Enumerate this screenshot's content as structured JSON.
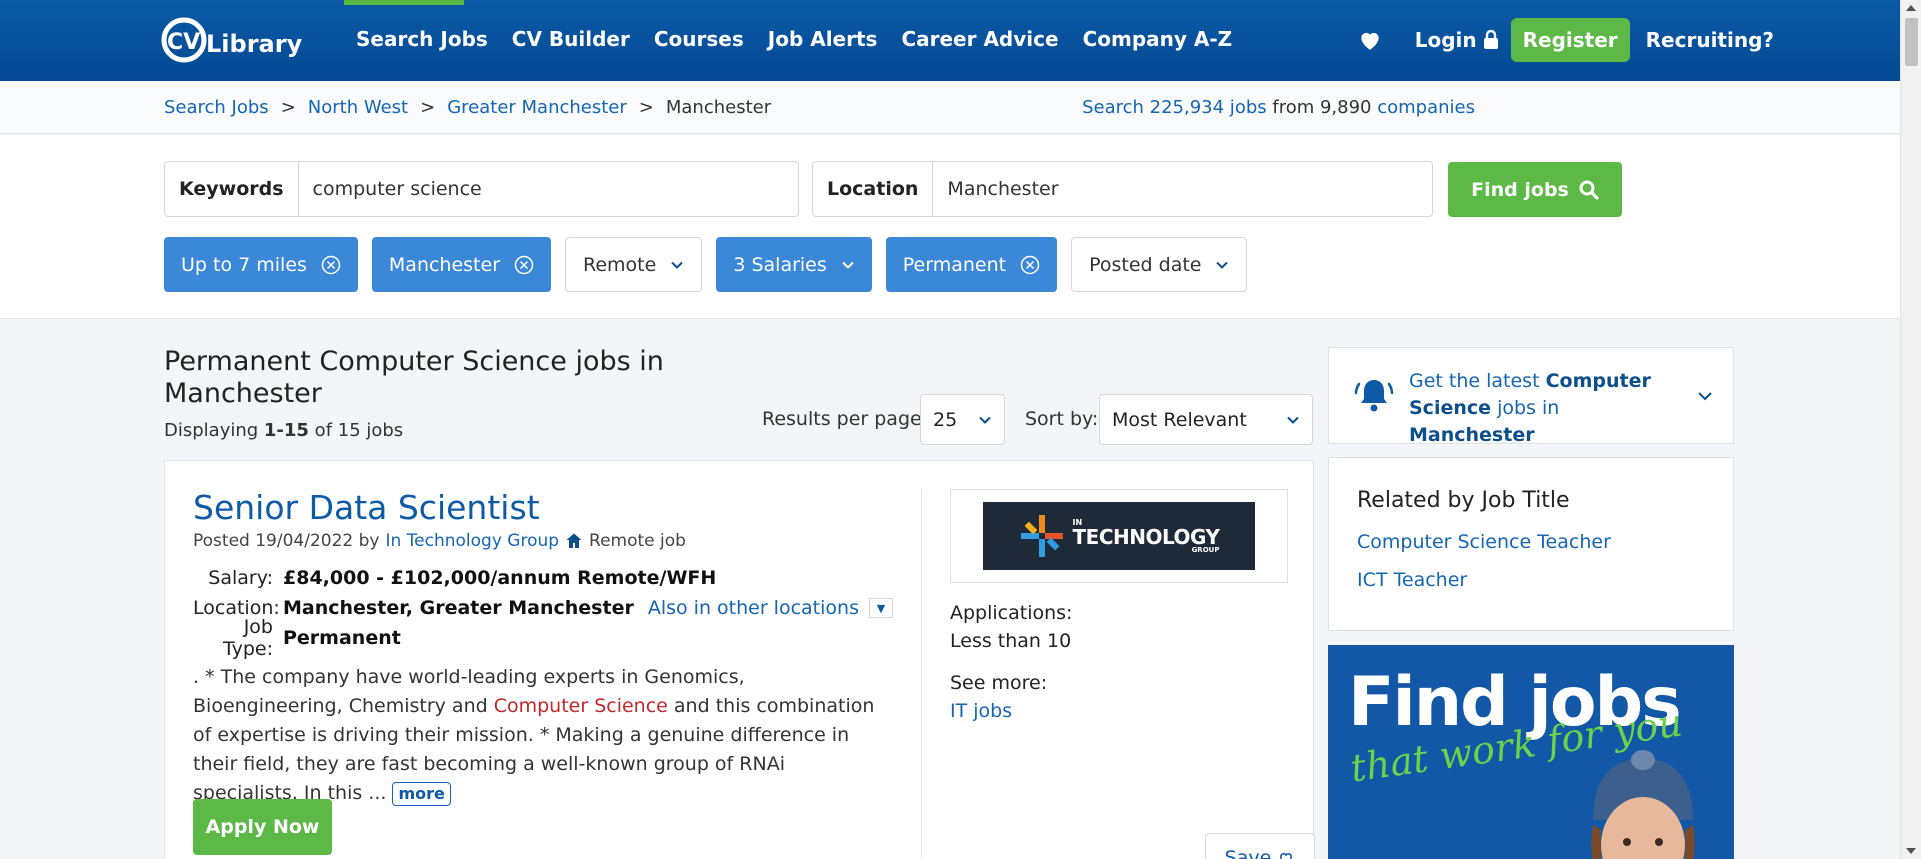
{
  "nav": {
    "links": [
      "Search Jobs",
      "CV Builder",
      "Courses",
      "Job Alerts",
      "Career Advice",
      "Company A-Z"
    ],
    "login": "Login",
    "register": "Register",
    "recruiting": "Recruiting?",
    "logo_text": "CV Library"
  },
  "breadcrumb": {
    "items": [
      "Search Jobs",
      "North West",
      "Greater Manchester"
    ],
    "current": "Manchester",
    "separator": ">"
  },
  "stats": {
    "prefix": "Search 225,934 jobs",
    "middle": " from 9,890 ",
    "suffix": "companies"
  },
  "search": {
    "keywords_label": "Keywords",
    "keywords_value": "computer science",
    "location_label": "Location",
    "location_value": "Manchester",
    "button": "Find jobs"
  },
  "filters": [
    {
      "label": "Up to 7 miles",
      "active": true
    },
    {
      "label": "Manchester",
      "active": true
    },
    {
      "label": "Remote",
      "active": false
    },
    {
      "label": "3 Salaries",
      "active": true
    },
    {
      "label": "Permanent",
      "active": true
    },
    {
      "label": "Posted date",
      "active": false
    }
  ],
  "results": {
    "title": "Permanent Computer Science jobs in Manchester",
    "displaying_prefix": "Displaying ",
    "displaying_range": "1-15",
    "displaying_suffix": " of 15 jobs",
    "per_page_label": "Results per page:",
    "per_page_value": "25",
    "sort_label": "Sort by:",
    "sort_value": "Most Relevant"
  },
  "job": {
    "title": "Senior Data Scientist",
    "posted_prefix": "Posted 19/04/2022 by",
    "company": "In Technology Group",
    "remote": "Remote job",
    "salary_label": "Salary:",
    "salary_value": "£84,000 - £102,000/annum Remote/WFH",
    "location_label": "Location:",
    "location_value": "Manchester, Greater Manchester",
    "other_locations": "Also in other locations",
    "type_label": "Job Type:",
    "type_value": "Permanent",
    "desc_part1": ". * The company have world-leading experts in Genomics, Bioengineering, Chemistry and ",
    "desc_highlight": "Computer Science",
    "desc_part2": " and this combination of expertise is driving their mission. * Making a genuine difference in their field, they are fast becoming a well-known group of RNAi specialists. In this ... ",
    "more": "more",
    "apply": "Apply Now",
    "applications_label": "Applications:",
    "applications_value": "Less than 10",
    "see_more_label": "See more:",
    "see_more_link": "IT jobs",
    "save": "Save",
    "logo_small": "IN",
    "logo_big": "TECHNOLOGY",
    "logo_group": "GROUP"
  },
  "sidebar": {
    "alert_prefix": "Get the latest ",
    "alert_bold1": "Computer Science",
    "alert_middle": " jobs in ",
    "alert_bold2": "Manchester",
    "related_title": "Related by Job Title",
    "related_links": [
      "Computer Science Teacher",
      "ICT Teacher"
    ],
    "ad_title": "Find jobs",
    "ad_sub": "that work for you"
  },
  "colors": {
    "brand_blue": "#054993",
    "accent_green": "#5cb946",
    "chip_blue": "#3b87d8",
    "link": "#1565b5"
  }
}
